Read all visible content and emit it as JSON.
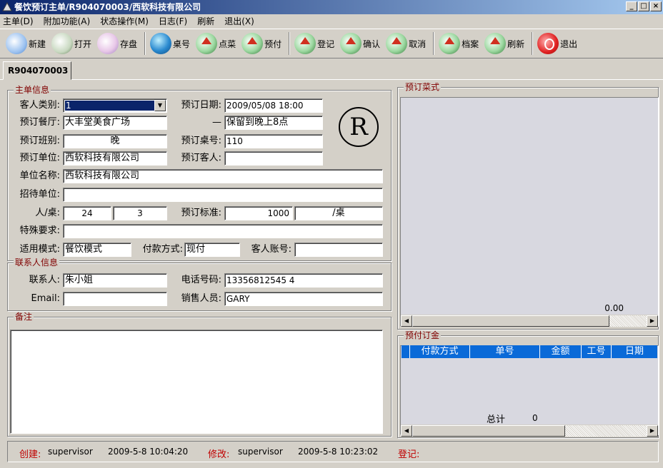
{
  "window": {
    "title": "餐饮预订主单/R904070003/西软科技有限公司",
    "min": "_",
    "max": "□",
    "close": "×"
  },
  "menu": [
    "主单(D)",
    "附加功能(A)",
    "状态操作(M)",
    "日志(F)",
    "刷新",
    "退出(X)"
  ],
  "toolbar": [
    {
      "label": "新建",
      "icon": "new-icon"
    },
    {
      "label": "打开",
      "icon": "open-icon"
    },
    {
      "label": "存盘",
      "icon": "save-icon"
    },
    {
      "label": "桌号",
      "icon": "globe-icon"
    },
    {
      "label": "点菜",
      "icon": "house-icon"
    },
    {
      "label": "预付",
      "icon": "house-icon"
    },
    {
      "label": "登记",
      "icon": "house-icon"
    },
    {
      "label": "确认",
      "icon": "house-icon"
    },
    {
      "label": "取消",
      "icon": "house-icon"
    },
    {
      "label": "档案",
      "icon": "house-icon"
    },
    {
      "label": "刷新",
      "icon": "house-icon"
    },
    {
      "label": "退出",
      "icon": "exit-icon"
    }
  ],
  "tab": "R904070003",
  "main": {
    "title": "主单信息",
    "guest_type_label": "客人类别:",
    "guest_type": "1",
    "book_date_label": "预订日期:",
    "book_date": "2009/05/08 18:00",
    "restaurant_label": "预订餐厅:",
    "restaurant": "大丰堂美食广场",
    "dash": "—",
    "hold": "保留到晚上8点",
    "shift_label": "预订班别:",
    "shift": "晚",
    "table_label": "预订桌号:",
    "table": "110",
    "unit_label": "预订单位:",
    "unit": "西软科技有限公司",
    "guest_label": "预订客人:",
    "guest": "",
    "company_label": "单位名称:",
    "company": "西软科技有限公司",
    "host_label": "招待单位:",
    "host": "",
    "people_label": "人/桌:",
    "people": "24",
    "tables": "3",
    "standard_label": "预订标准:",
    "standard": "1000",
    "per_table": "/桌",
    "special_label": "特殊要求:",
    "special": "",
    "mode_label": "适用模式:",
    "mode": "餐饮模式",
    "pay_label": "付款方式:",
    "pay": "现付",
    "account_label": "客人账号:",
    "account": "",
    "mark": "R"
  },
  "contact": {
    "title": "联系人信息",
    "person_label": "联系人:",
    "person": "朱小姐",
    "phone_label": "电话号码:",
    "phone": "13356812545 4",
    "email_label": "Email:",
    "email": "",
    "sales_label": "销售人员:",
    "sales": "GARY"
  },
  "remarks": {
    "title": "备注"
  },
  "dishes": {
    "title": "预订菜式",
    "total": "0.00"
  },
  "deposit": {
    "title": "预付订金",
    "columns": [
      "付款方式",
      "单号",
      "金额",
      "工号",
      "日期"
    ],
    "total_label": "总计",
    "total": "0"
  },
  "status": {
    "created_label": "创建:",
    "created_by": "supervisor",
    "created_at": "2009-5-8 10:04:20",
    "modified_label": "修改:",
    "modified_by": "supervisor",
    "modified_at": "2009-5-8 10:23:02",
    "registered_label": "登记:"
  }
}
